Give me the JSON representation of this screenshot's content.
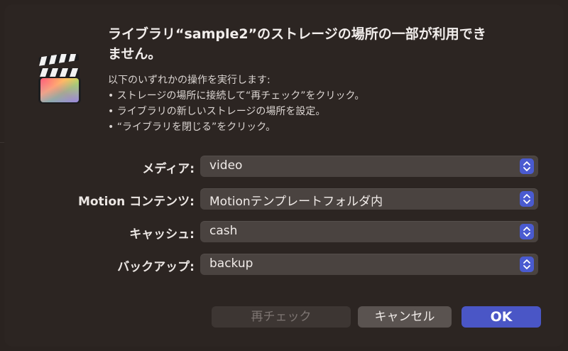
{
  "dialog": {
    "title_line1": "ライブラリ“sample2”のストレージの場所の一部が利用でき",
    "title_line2": "ません。",
    "description": {
      "intro": "以下のいずれかの操作を実行します:",
      "bullets": [
        "• ストレージの場所に接続して“再チェック”をクリック。",
        "• ライブラリの新しいストレージの場所を設定。",
        "• “ライブラリを閉じる”をクリック。"
      ]
    },
    "app_icon": "final-cut-pro-clapperboard-icon",
    "fields": [
      {
        "label": "メディア:",
        "value": "video"
      },
      {
        "label": "Motion コンテンツ:",
        "value": "Motionテンプレートフォルダ内"
      },
      {
        "label": "キャッシュ:",
        "value": "cash"
      },
      {
        "label": "バックアップ:",
        "value": "backup"
      }
    ],
    "buttons": {
      "recheck": "再チェック",
      "cancel": "キャンセル",
      "ok": "OK"
    },
    "colors": {
      "background": "#2c2522",
      "accent": "#4a56c6",
      "select_bg": "#4a4340"
    }
  }
}
